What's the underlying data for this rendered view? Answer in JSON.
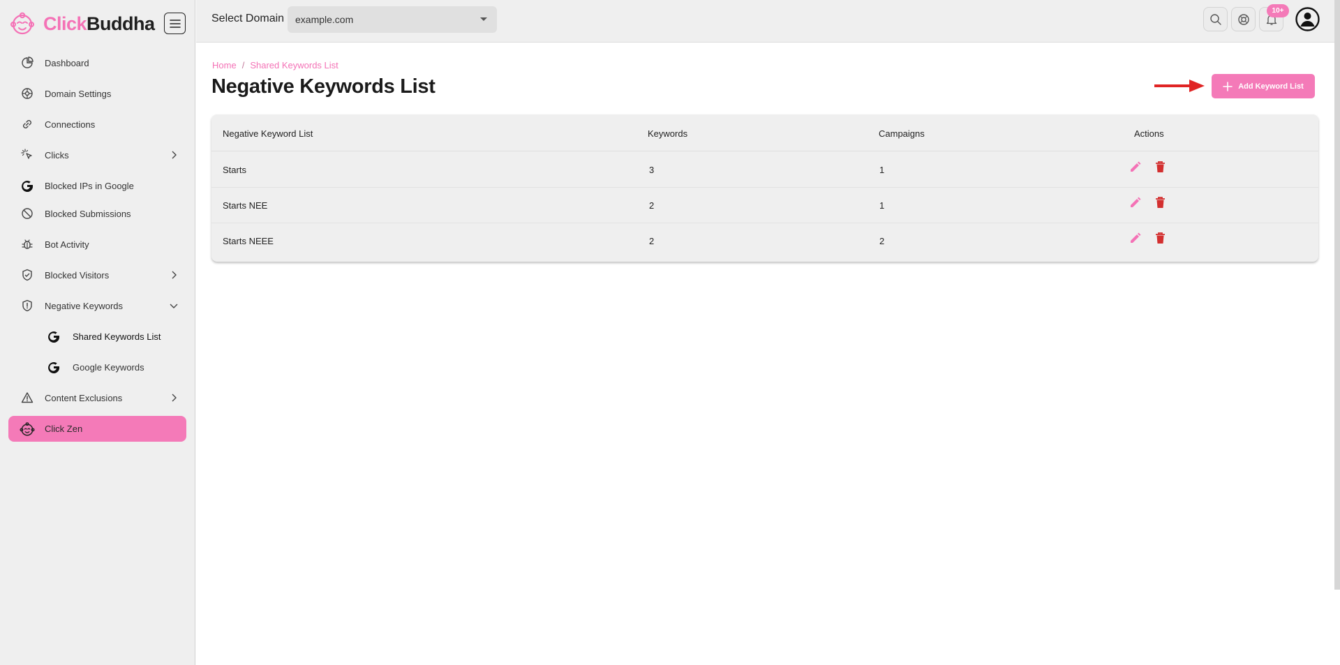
{
  "brand": {
    "part1": "Click",
    "part2": "Buddha"
  },
  "sidebar": {
    "items": [
      {
        "label": "Dashboard",
        "icon": "dashboard-icon"
      },
      {
        "label": "Domain Settings",
        "icon": "gear-icon"
      },
      {
        "label": "Connections",
        "icon": "link-icon"
      },
      {
        "label": "Clicks",
        "icon": "click-icon"
      },
      {
        "label": "Blocked IPs in Google",
        "icon": "google-icon"
      },
      {
        "label": "Blocked Submissions",
        "icon": "ban-icon"
      },
      {
        "label": "Bot Activity",
        "icon": "bug-icon"
      },
      {
        "label": "Blocked Visitors",
        "icon": "shield-check-icon"
      },
      {
        "label": "Negative Keywords",
        "icon": "shield-alert-icon"
      },
      {
        "label": "Shared Keywords List",
        "icon": "google-icon"
      },
      {
        "label": "Google Keywords",
        "icon": "google-icon"
      },
      {
        "label": "Content Exclusions",
        "icon": "warning-icon"
      },
      {
        "label": "Click Zen",
        "icon": "buddha-icon"
      }
    ]
  },
  "topbar": {
    "domain_label": "Select Domain",
    "domain_value": "example.com",
    "notifications_badge": "10+"
  },
  "breadcrumb": {
    "home": "Home",
    "separator": "/",
    "current": "Shared Keywords List"
  },
  "page": {
    "title": "Negative Keywords List",
    "add_button": "Add Keyword List"
  },
  "table": {
    "headers": [
      "Negative Keyword List",
      "Keywords",
      "Campaigns",
      "Actions"
    ],
    "rows": [
      {
        "name": "Starts",
        "keywords": "3",
        "campaigns": "1"
      },
      {
        "name": "Starts NEE",
        "keywords": "2",
        "campaigns": "1"
      },
      {
        "name": "Starts NEEE",
        "keywords": "2",
        "campaigns": "2"
      }
    ]
  },
  "colors": {
    "accent": "#f47ab8",
    "delete": "#d32f2f",
    "arrow": "#e02424"
  }
}
